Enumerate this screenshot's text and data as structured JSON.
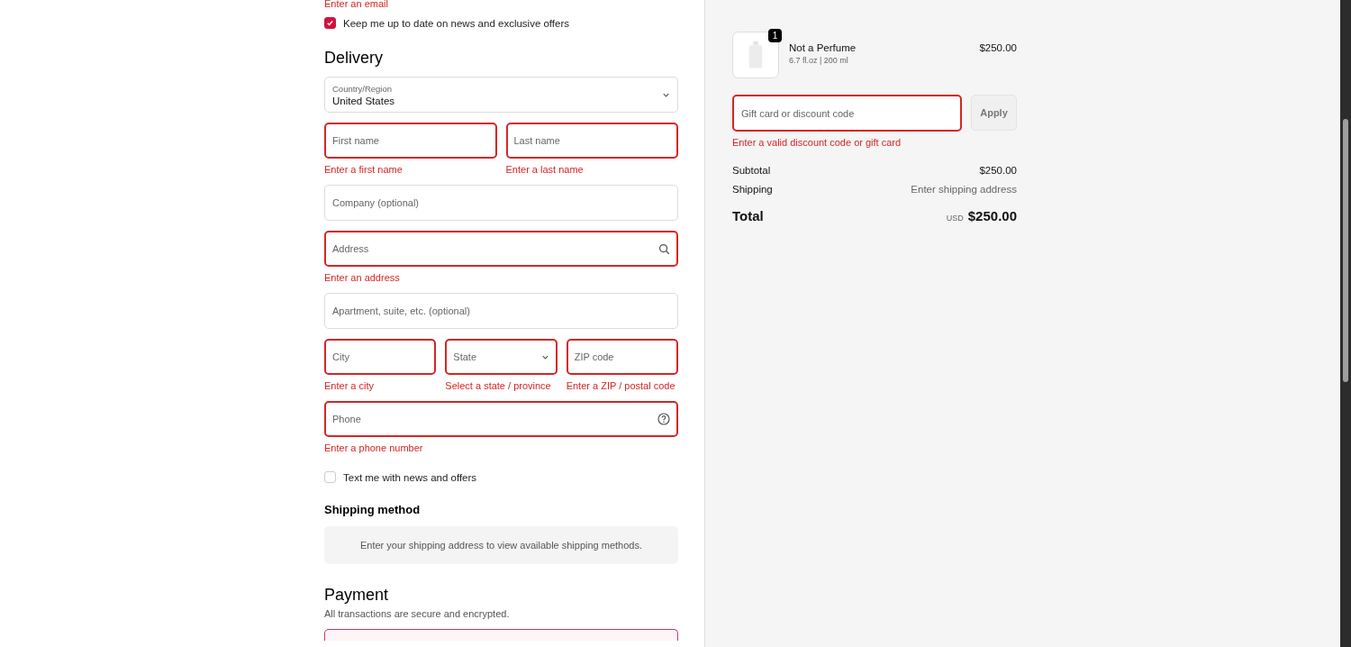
{
  "contact": {
    "email_error": "Enter an email",
    "marketing": {
      "label": "Keep me up to date on news and exclusive offers",
      "checked": true
    }
  },
  "delivery": {
    "title": "Delivery",
    "rows": [
      [
        {
          "kind": "select",
          "label": "Country/Region",
          "value": "United States",
          "invalid": false
        }
      ],
      [
        {
          "kind": "text",
          "placeholder": "First name",
          "invalid": true,
          "error": "Enter a first name"
        },
        {
          "kind": "text",
          "placeholder": "Last name",
          "invalid": true,
          "error": "Enter a last name"
        }
      ],
      [
        {
          "kind": "text",
          "placeholder": "Company (optional)",
          "invalid": false
        }
      ],
      [
        {
          "kind": "search",
          "placeholder": "Address",
          "invalid": true,
          "error": "Enter an address"
        }
      ],
      [
        {
          "kind": "text",
          "placeholder": "Apartment, suite, etc. (optional)",
          "invalid": false
        }
      ],
      [
        {
          "kind": "text",
          "placeholder": "City",
          "invalid": true,
          "error": "Enter a city"
        },
        {
          "kind": "select",
          "placeholder": "State",
          "invalid": true,
          "error": "Select a state / province"
        },
        {
          "kind": "text",
          "placeholder": "ZIP code",
          "invalid": true,
          "error": "Enter a ZIP / postal code"
        }
      ],
      [
        {
          "kind": "help",
          "placeholder": "Phone",
          "invalid": true,
          "error": "Enter a phone number"
        }
      ]
    ],
    "sms": {
      "label": "Text me with news and offers",
      "checked": false
    }
  },
  "shipping_method": {
    "title": "Shipping method",
    "notice": "Enter your shipping address to view available shipping methods."
  },
  "payment": {
    "title": "Payment",
    "subtitle": "All transactions are secure and encrypted."
  },
  "summary": {
    "item": {
      "name": "Not a Perfume",
      "variant": "6.7 fl.oz | 200 ml",
      "quantity": "1",
      "price": "$250.00"
    },
    "discount": {
      "placeholder": "Gift card or discount code",
      "invalid": true,
      "error": "Enter a valid discount code or gift card",
      "button": "Apply"
    },
    "lines": [
      {
        "label": "Subtotal",
        "value": "$250.00",
        "kind": "amount"
      },
      {
        "label": "Shipping",
        "value": "Enter shipping address",
        "kind": "note"
      }
    ],
    "total": {
      "label": "Total",
      "currency": "USD",
      "value": "$250.00"
    }
  }
}
